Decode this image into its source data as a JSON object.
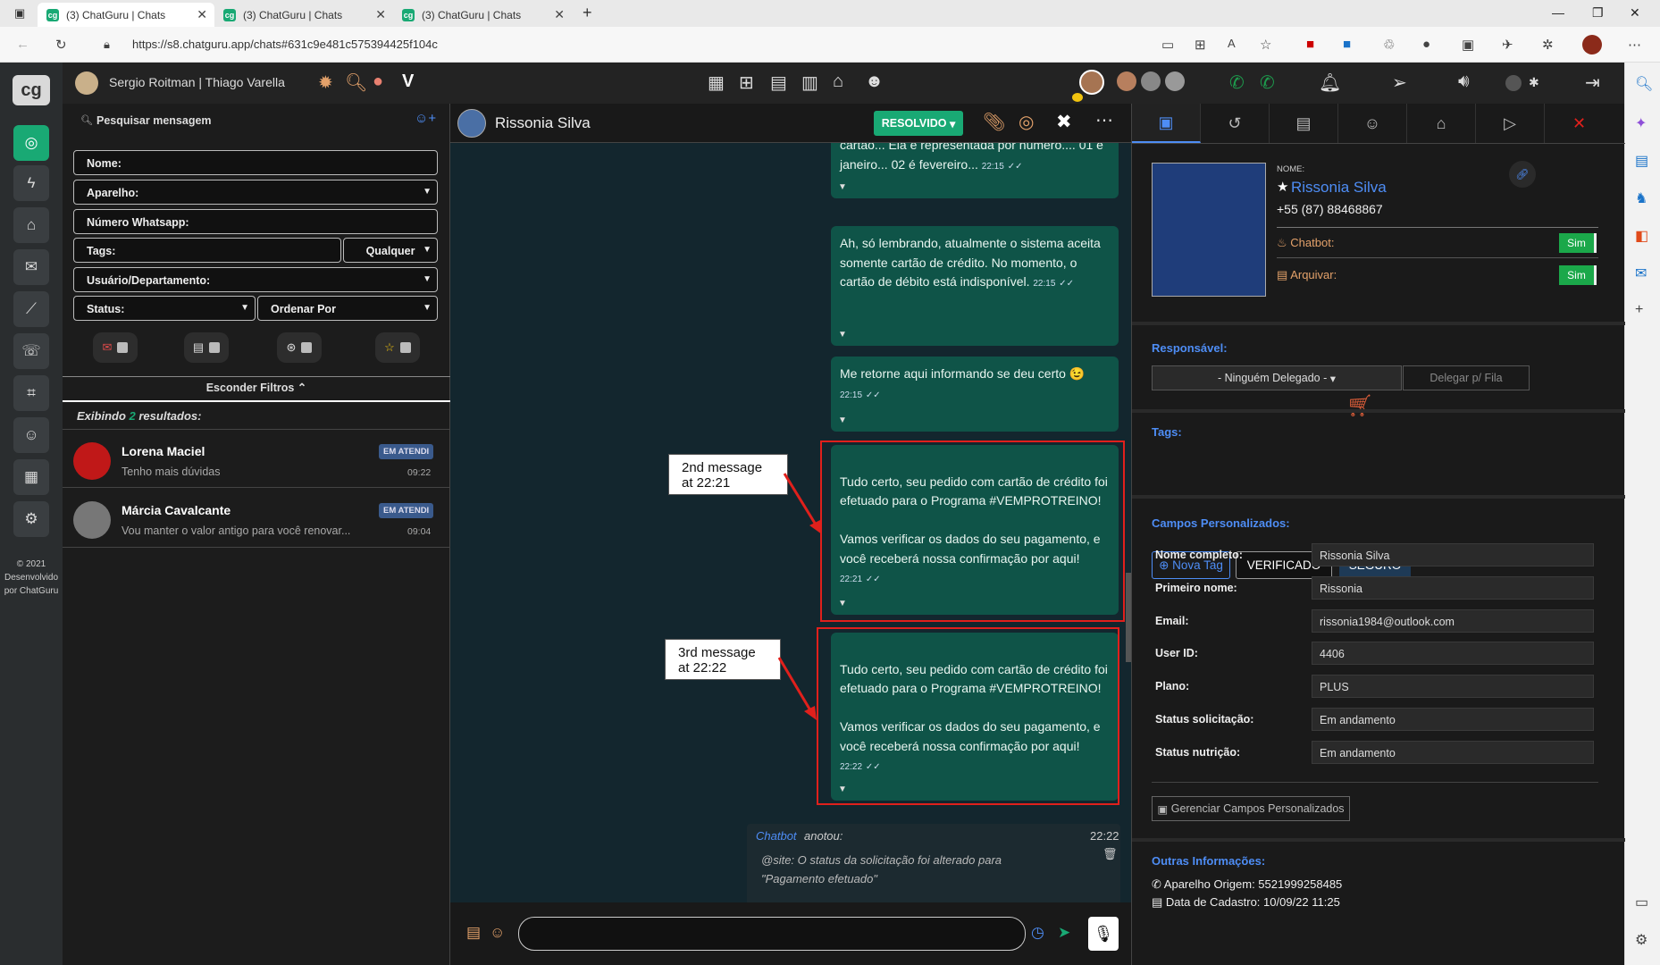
{
  "browser": {
    "tabs": [
      {
        "title": "(3) ChatGuru | Chats",
        "active": true
      },
      {
        "title": "(3) ChatGuru | Chats",
        "active": false
      },
      {
        "title": "(3) ChatGuru | Chats",
        "active": false
      }
    ],
    "url": "https://s8.chatguru.app/chats#631c9e481c575394425f104c"
  },
  "header": {
    "user_names": "Sergio Roitman | Thiago Varella",
    "logo": "cg"
  },
  "rail": {
    "footer": [
      "© 2021",
      "Desenvolvido",
      "por ChatGuru"
    ]
  },
  "filters": {
    "search_placeholder": "Pesquisar mensagem",
    "nome": "Nome:",
    "aparelho": "Aparelho:",
    "numero": "Número Whatsapp:",
    "tags": "Tags:",
    "qualquer": "Qualquer",
    "usuario": "Usuário/Departamento:",
    "status": "Status:",
    "ordenar": "Ordenar Por",
    "hide": "Esconder Filtros ⌃"
  },
  "results": {
    "prefix": "Exibindo",
    "count": "2",
    "suffix": "resultados:"
  },
  "contacts": [
    {
      "name": "Lorena Maciel",
      "preview": "Tenho mais dúvidas",
      "time": "09:22",
      "badge": "EM ATENDI"
    },
    {
      "name": "Márcia Cavalcante",
      "preview": "Vou manter o valor antigo para você renovar...",
      "time": "09:04",
      "badge": "EM ATENDI"
    }
  ],
  "chat": {
    "contact": "Rissonia Silva",
    "status_button": "RESOLVIDO",
    "messages": [
      {
        "text": "cartão... Ela é representada por número.... 01 é janeiro... 02 é fevereiro...",
        "time": "22:15"
      },
      {
        "text": "Ah, só lembrando, atualmente o sistema aceita somente cartão de crédito. No momento, o cartão de débito está indisponível.",
        "time": "22:15"
      },
      {
        "text": "Me retorne aqui informando se deu certo 😉",
        "time": "22:15"
      },
      {
        "text": "Tudo certo, seu pedido com cartão de crédito foi efetuado para o Programa #VEMPROTREINO!\n\nVamos verificar os dados do seu pagamento, e você receberá nossa confirmação por aqui!",
        "time": "22:21"
      },
      {
        "text": "Tudo certo, seu pedido com cartão de crédito foi efetuado para o Programa #VEMPROTREINO!\n\nVamos verificar os dados do seu pagamento, e você receberá nossa confirmação por aqui!",
        "time": "22:22"
      }
    ],
    "callouts": [
      "2nd message\nat 22:21",
      "3rd message\nat 22:22"
    ],
    "note": {
      "author": "Chatbot",
      "verb": "anotou:",
      "time": "22:22",
      "text": "@site: O status da solicitação foi alterado para \"Pagamento efetuado\""
    }
  },
  "profile": {
    "nome_label": "NOME:",
    "name": "Rissonia Silva",
    "phone": "+55 (87) 88468867",
    "chatbot_label": "Chatbot:",
    "arquivar_label": "Arquivar:",
    "sim": "Sim",
    "responsavel_label": "Responsável:",
    "delegado": "- Ninguém Delegado -",
    "delegar": "Delegar p/ Fila",
    "tags_label": "Tags:",
    "tags": [
      "Nova Tag",
      "VERIFICADO",
      "SEGURO"
    ],
    "campos_label": "Campos Personalizados:",
    "fields": [
      {
        "k": "Nome completo:",
        "v": "Rissonia Silva"
      },
      {
        "k": "Primeiro nome:",
        "v": "Rissonia"
      },
      {
        "k": "Email:",
        "v": "rissonia1984@outlook.com"
      },
      {
        "k": "User ID:",
        "v": "4406"
      },
      {
        "k": "Plano:",
        "v": "PLUS"
      },
      {
        "k": "Status solicitação:",
        "v": "Em andamento"
      },
      {
        "k": "Status nutrição:",
        "v": "Em andamento"
      }
    ],
    "gerenciar": "Gerenciar Campos Personalizados",
    "outras_label": "Outras Informações:",
    "aparelho": "Aparelho Origem: 5521999258485",
    "cadastro": "Data de Cadastro: 10/09/22 11:25"
  },
  "colors": {
    "accent_green": "#19a974",
    "bubble": "#0f5448",
    "link_blue": "#4e8df5",
    "red_annotation": "#e0201c"
  }
}
